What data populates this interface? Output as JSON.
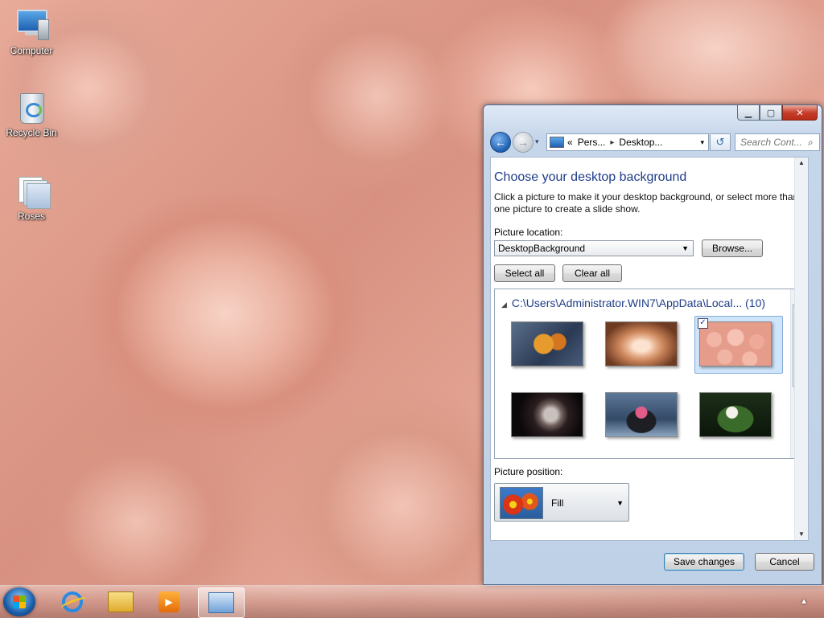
{
  "desktop": {
    "icons": [
      {
        "label": "Computer"
      },
      {
        "label": "Recycle Bin"
      },
      {
        "label": "Roses"
      }
    ]
  },
  "window": {
    "controls": {
      "minimize": "▁",
      "maximize": "▢",
      "close": "✕"
    },
    "nav": {
      "back": "←",
      "forward": "→",
      "dropdown": "▾"
    },
    "address": {
      "chevron": "«",
      "segments": [
        "Pers...",
        "Desktop..."
      ],
      "separator": "▸",
      "dropdown": "▾"
    },
    "refresh": "↺",
    "search": {
      "placeholder": "Search Cont...",
      "icon": "⌕"
    },
    "heading": "Choose your desktop background",
    "description": "Click a picture to make it your desktop background, or select more than one picture to create a slide show.",
    "picture_location_label": "Picture location:",
    "picture_location_value": "DesktopBackground",
    "browse_label": "Browse...",
    "select_all_label": "Select all",
    "clear_all_label": "Clear all",
    "gallery": {
      "group_title": "C:\\Users\\Administrator.WIN7\\AppData\\Local...",
      "group_count": "(10)",
      "thumbnails": [
        {
          "name": "roses-on-blue",
          "selected": false
        },
        {
          "name": "rose-closeup",
          "selected": false
        },
        {
          "name": "pink-roses",
          "selected": true
        },
        {
          "name": "dark-rose",
          "selected": false
        },
        {
          "name": "pink-flower-stones",
          "selected": false
        },
        {
          "name": "white-rose-garden",
          "selected": false
        }
      ],
      "check_mark": "✓"
    },
    "picture_position_label": "Picture position:",
    "picture_position_value": "Fill",
    "save_label": "Save changes",
    "cancel_label": "Cancel"
  },
  "taskbar": {
    "media_glyph": "▶",
    "tray_arrow": "▲"
  },
  "colors": {
    "heading": "#1f3c88",
    "selection": "#cfe5fb"
  }
}
